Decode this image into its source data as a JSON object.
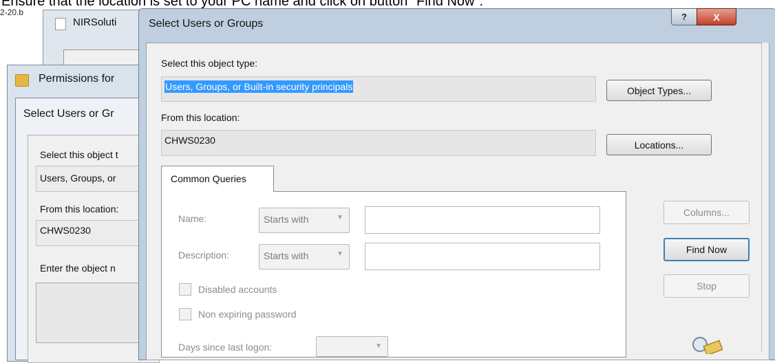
{
  "caption": "Ensure that the location is set to your PC name and click on button \"Find Now\".",
  "file_label": "2-20.b",
  "nir_window": {
    "title": "NIRSoluti"
  },
  "permissions_window": {
    "title": "Permissions for"
  },
  "back_dialog": {
    "title": "Select Users or Gr",
    "object_type_label": "Select this object t",
    "object_type_value": "Users, Groups, or",
    "location_label": "From this location:",
    "location_value": "CHWS0230",
    "enter_names_label": "Enter the object n"
  },
  "dialog": {
    "title": "Select Users or Groups",
    "help_glyph": "?",
    "close_glyph": "X",
    "object_type_label": "Select this object type:",
    "object_type_value": "Users, Groups, or Built-in security principals",
    "object_types_button": "Object Types...",
    "location_label": "From this location:",
    "location_value": "CHWS0230",
    "locations_button": "Locations...",
    "tab_label": "Common Queries",
    "name_label": "Name:",
    "name_mode": "Starts with",
    "name_value": "",
    "description_label": "Description:",
    "description_mode": "Starts with",
    "description_value": "",
    "disabled_accounts_label": "Disabled accounts",
    "non_expiring_label": "Non expiring password",
    "days_label": "Days since last logon:",
    "columns_button": "Columns...",
    "find_now_button": "Find Now",
    "stop_button": "Stop"
  }
}
